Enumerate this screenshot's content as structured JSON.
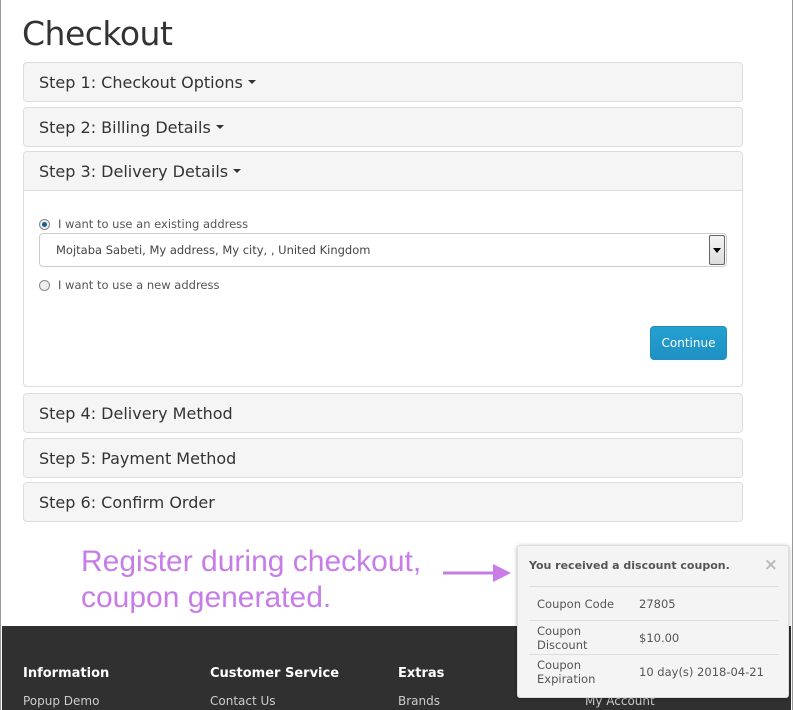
{
  "page_title": "Checkout",
  "steps": [
    {
      "label": "Step 1: Checkout Options",
      "has_caret": true
    },
    {
      "label": "Step 2: Billing Details",
      "has_caret": true
    },
    {
      "label": "Step 3: Delivery Details",
      "has_caret": true
    },
    {
      "label": "Step 4: Delivery Method"
    },
    {
      "label": "Step 5: Payment Method"
    },
    {
      "label": "Step 6: Confirm Order"
    }
  ],
  "delivery": {
    "existing_label": "I want to use an existing address",
    "existing_selected": true,
    "address_value": "Mojtaba Sabeti, My address, My city, , United Kingdom",
    "new_label": "I want to use a new address",
    "continue_label": "Continue"
  },
  "annotation": {
    "line1": "Register during checkout,",
    "line2": "coupon generated.",
    "color": "#c77ce8"
  },
  "coupon_popup": {
    "title": "You received a discount coupon.",
    "close": "×",
    "rows": [
      {
        "key": "Coupon Code",
        "value": "27805"
      },
      {
        "key": "Coupon Discount",
        "value": "$10.00"
      },
      {
        "key": "Coupon Expiration",
        "value": "10 day(s) 2018-04-21"
      }
    ]
  },
  "footer": {
    "columns": [
      {
        "heading": "Information",
        "link": "Popup Demo"
      },
      {
        "heading": "Customer Service",
        "link": "Contact Us"
      },
      {
        "heading": "Extras",
        "link": "Brands"
      },
      {
        "heading": "",
        "link": "My Account"
      }
    ]
  },
  "colors": {
    "primary_button": "#229ac8",
    "footer_bg": "#303030"
  }
}
